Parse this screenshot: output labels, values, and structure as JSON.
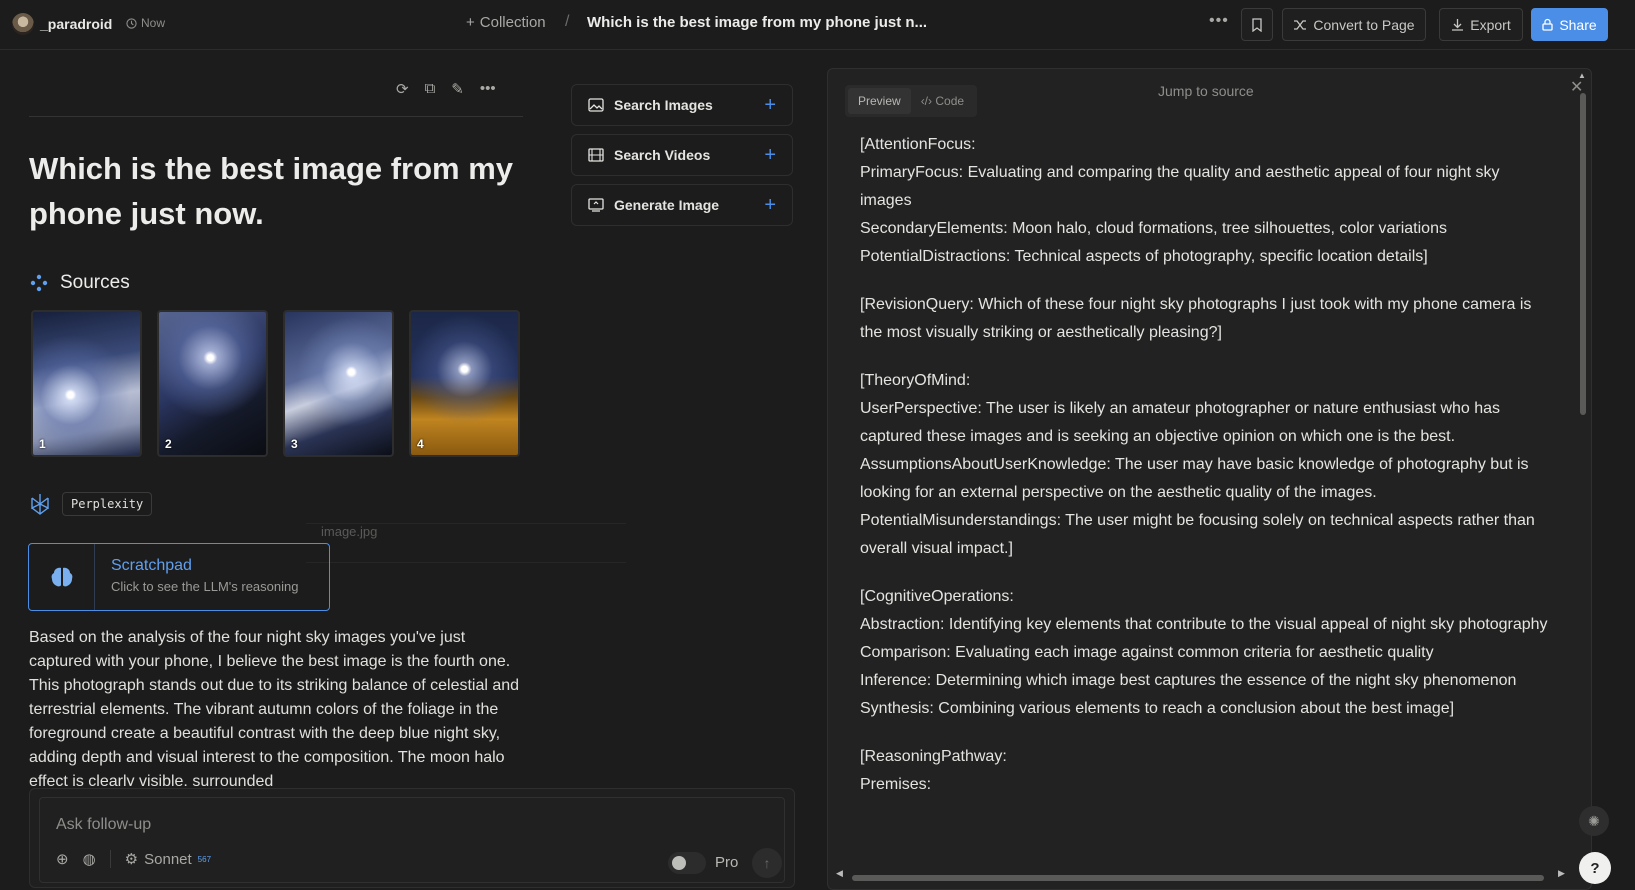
{
  "header": {
    "username": "_paradroid",
    "time": "Now",
    "collection_label": "Collection",
    "title": "Which is the best image from my phone just n...",
    "convert_label": "Convert to Page",
    "export_label": "Export",
    "share_label": "Share"
  },
  "thread": {
    "question": "Which is the best image from my phone just now.",
    "sources_label": "Sources",
    "images": [
      {
        "number": "1"
      },
      {
        "number": "2"
      },
      {
        "number": "3"
      },
      {
        "number": "4"
      }
    ],
    "image_filename": "image.jpg",
    "model_badge": "Perplexity",
    "scratchpad_title": "Scratchpad",
    "scratchpad_subtitle": "Click to see the LLM's reasoning",
    "answer": "Based on the analysis of the four night sky images you've just captured with your phone, I believe the best image is the fourth one. This photograph stands out due to its striking balance of celestial and terrestrial elements. The vibrant autumn colors of the foliage in the foreground create a beautiful contrast with the deep blue night sky, adding depth and visual interest to the composition. The moon halo effect is clearly visible, surrounded"
  },
  "side_actions": {
    "search_images": "Search Images",
    "search_videos": "Search Videos",
    "generate_image": "Generate Image"
  },
  "followup": {
    "placeholder": "Ask follow-up",
    "model": "Sonnet",
    "model_count": "567",
    "pro_label": "Pro"
  },
  "panel": {
    "tab_preview": "Preview",
    "tab_code": "Code",
    "jump_label": "Jump to source",
    "paragraphs": [
      [
        "[AttentionFocus:",
        "PrimaryFocus: Evaluating and comparing the quality and aesthetic appeal of four night sky images",
        "SecondaryElements: Moon halo, cloud formations, tree silhouettes, color variations",
        "PotentialDistractions: Technical aspects of photography, specific location details]"
      ],
      [
        "[RevisionQuery: Which of these four night sky photographs I just took with my phone camera is the most visually striking or aesthetically pleasing?]"
      ],
      [
        "[TheoryOfMind:",
        "UserPerspective: The user is likely an amateur photographer or nature enthusiast who has captured these images and is seeking an objective opinion on which one is the best.",
        "AssumptionsAboutUserKnowledge: The user may have basic knowledge of photography but is looking for an external perspective on the aesthetic quality of the images.",
        "PotentialMisunderstandings: The user might be focusing solely on technical aspects rather than overall visual impact.]"
      ],
      [
        "[CognitiveOperations:",
        "Abstraction: Identifying key elements that contribute to the visual appeal of night sky photography",
        "Comparison: Evaluating each image against common criteria for aesthetic quality",
        "Inference: Determining which image best captures the essence of the night sky phenomenon",
        "Synthesis: Combining various elements to reach a conclusion about the best image]"
      ],
      [
        "[ReasoningPathway:",
        "Premises:"
      ]
    ]
  },
  "colors": {
    "accent": "#4b8ee8",
    "background": "#1c1c1c",
    "panel": "#222222"
  }
}
